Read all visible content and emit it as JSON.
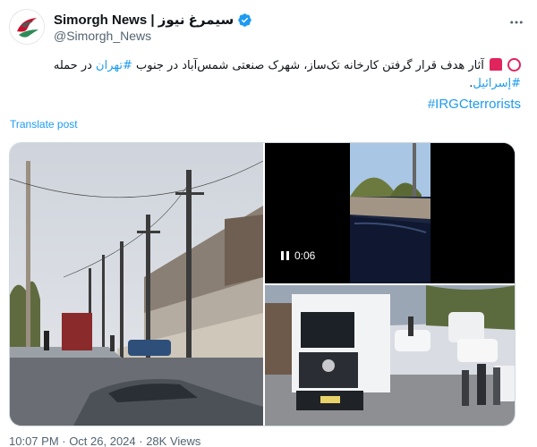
{
  "account": {
    "display_name": "Simorgh News | سیمرغ نیوز",
    "handle": "@Simorgh_News"
  },
  "tweet": {
    "text_part1": "آثار هدف قرار گرفتن کارخانه تک‌ساز، شهرک صنعتی شمس‌آباد در جنوب ",
    "hashtag_tehran": "#تهران",
    "text_part2": " در حمله ",
    "hashtag_israel": "#إسرائيل",
    "text_end": ".",
    "hashtag_irgc": "#IRGCterrorists"
  },
  "translate_label": "Translate post",
  "media": {
    "video_duration": "0:06"
  },
  "footer": {
    "timestamp": "10:07 PM · Oct 26, 2024",
    "views": "· 28K Views"
  },
  "colors": {
    "link": "#1d9bf0",
    "verified": "#1d9bf0",
    "accent_red": "#e0245e"
  },
  "icons": [
    "verified-badge-icon",
    "more-options-icon",
    "siren-emoji-icon",
    "red-circle-emoji-icon",
    "pause-icon"
  ]
}
